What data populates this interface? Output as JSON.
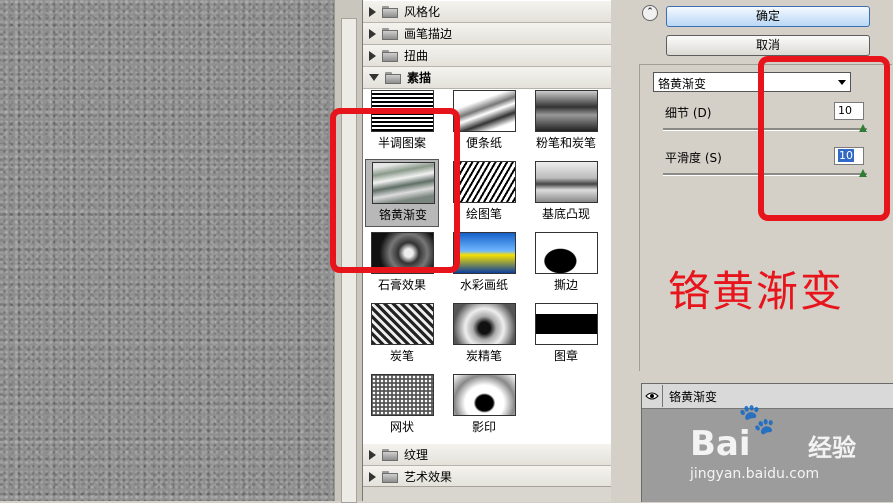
{
  "filters": {
    "categories_top": [
      {
        "label": "风格化",
        "open": false
      },
      {
        "label": "画笔描边",
        "open": false
      },
      {
        "label": "扭曲",
        "open": false
      },
      {
        "label": "素描",
        "open": true
      }
    ],
    "thumbnails": [
      {
        "label": "半调图案",
        "style": "t-halftone"
      },
      {
        "label": "便条纸",
        "style": "t-note"
      },
      {
        "label": "粉笔和炭笔",
        "style": "t-chalk"
      },
      {
        "label": "铬黄渐变",
        "style": "t-chrome",
        "selected": true
      },
      {
        "label": "绘图笔",
        "style": "t-graphic"
      },
      {
        "label": "基底凸现",
        "style": "t-basrelief"
      },
      {
        "label": "石膏效果",
        "style": "t-plaster"
      },
      {
        "label": "水彩画纸",
        "style": "t-watercolor"
      },
      {
        "label": "撕边",
        "style": "t-torn"
      },
      {
        "label": "炭笔",
        "style": "t-charcoal"
      },
      {
        "label": "炭精笔",
        "style": "t-conte"
      },
      {
        "label": "图章",
        "style": "t-stamp"
      },
      {
        "label": "网状",
        "style": "t-reticul"
      },
      {
        "label": "影印",
        "style": "t-photocopy"
      }
    ],
    "categories_bottom": [
      {
        "label": "纹理",
        "open": false
      },
      {
        "label": "艺术效果",
        "open": false
      }
    ]
  },
  "settings": {
    "ok_label": "确定",
    "cancel_label": "取消",
    "filter_select": "铬黄渐变",
    "params": [
      {
        "label": "细节 (D)",
        "value": "10",
        "level": 1.0,
        "focused": false
      },
      {
        "label": "平滑度 (S)",
        "value": "10",
        "level": 1.0,
        "focused": true
      }
    ]
  },
  "layers": [
    {
      "name": "铬黄渐变",
      "visible": true
    }
  ],
  "annotation": {
    "text": "铬黄渐变",
    "color": "#e8141c"
  },
  "watermark": {
    "brand": "Bai",
    "brand_cn": "经验",
    "url": "jingyan.baidu.com"
  }
}
